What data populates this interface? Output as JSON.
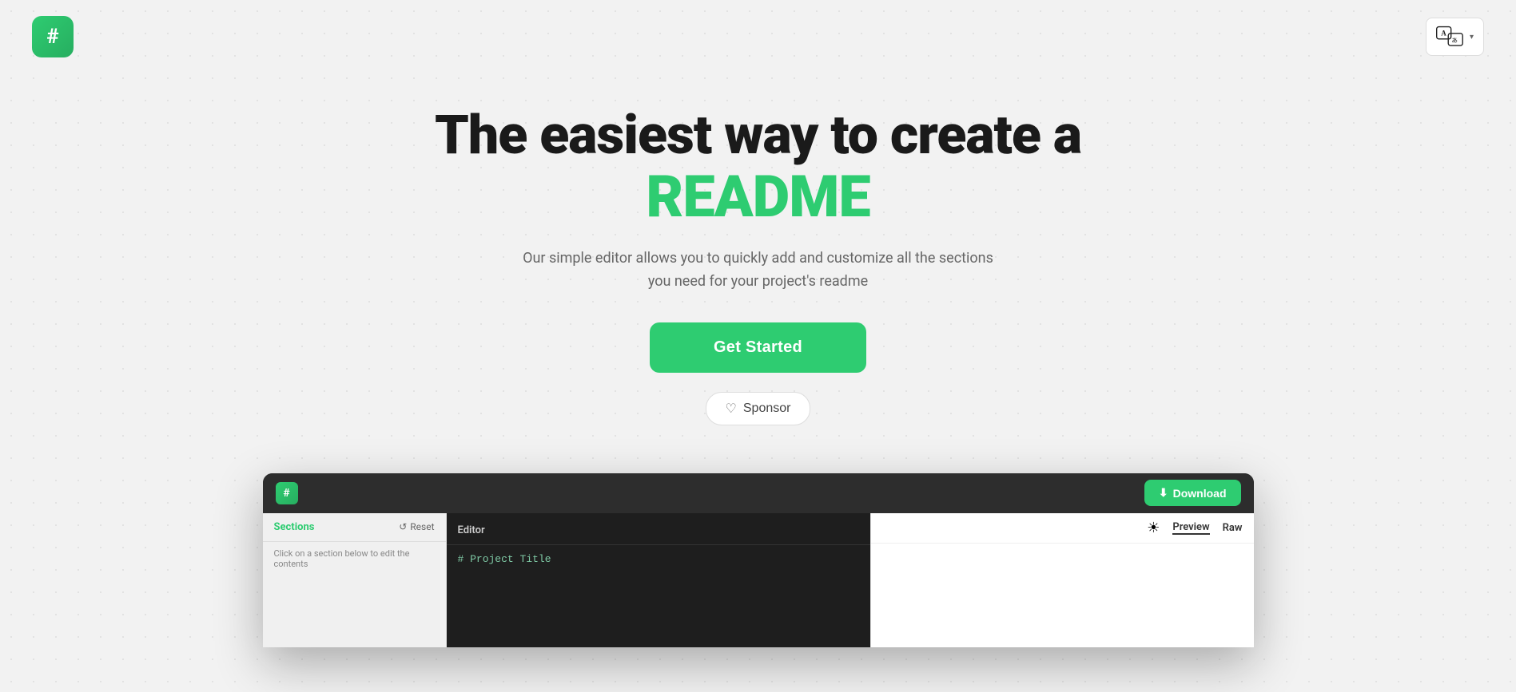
{
  "header": {
    "logo_symbol": "#",
    "translate_button_label": "Translate",
    "translate_chevron": "▾"
  },
  "hero": {
    "title_line1": "The easiest way to create a",
    "title_line2": "README",
    "subtitle": "Our simple editor allows you to quickly add and customize all the sections you need for your project's readme",
    "get_started_label": "Get Started",
    "sponsor_label": "Sponsor",
    "sponsor_heart": "♡"
  },
  "app_preview": {
    "logo_symbol": "#",
    "download_icon": "⬇",
    "download_label": "Download",
    "sections_title": "Sections",
    "reset_icon": "↺",
    "reset_label": "Reset",
    "sections_hint": "Click on a section below to edit the contents",
    "editor_label": "Editor",
    "editor_line": "# Project Title",
    "preview_tab": "Preview",
    "raw_tab": "Raw",
    "theme_icon": "☀"
  },
  "colors": {
    "green": "#2ecc71",
    "dark_bg": "#1e1e1e",
    "titlebar_bg": "#2d2d2d",
    "body_bg": "#f2f2f2"
  }
}
